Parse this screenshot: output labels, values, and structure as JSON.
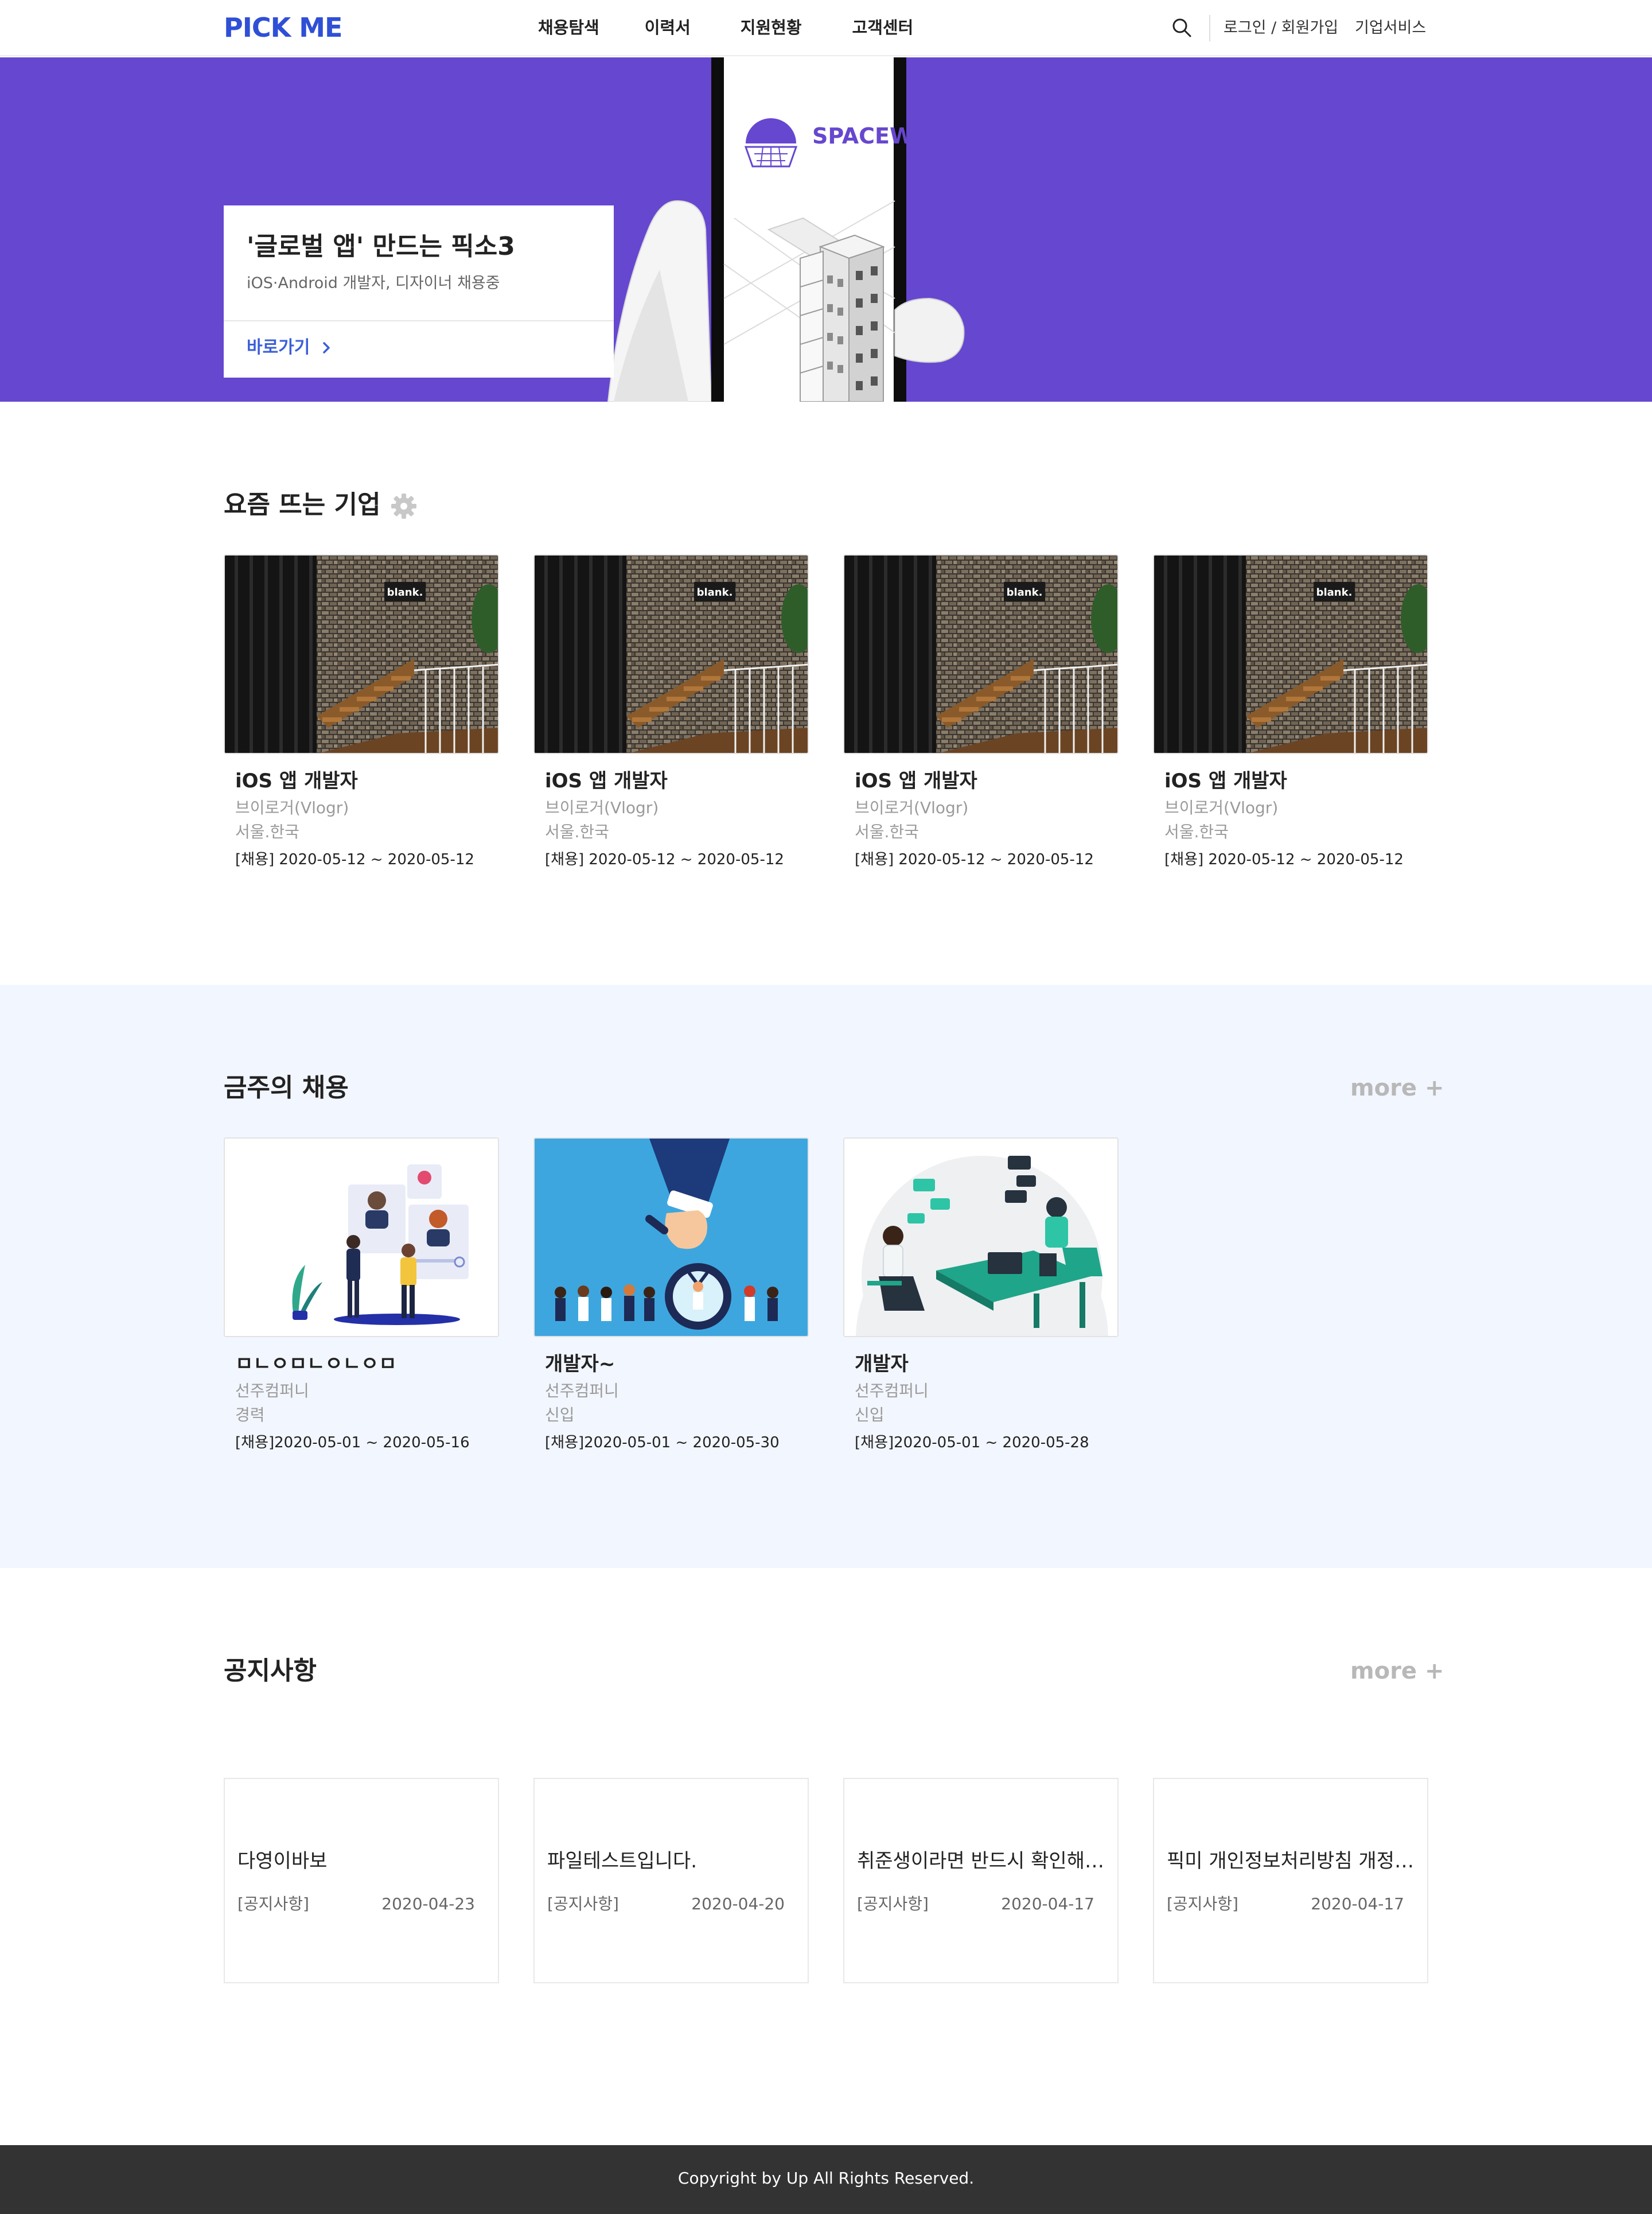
{
  "header": {
    "logo": "PICK ME",
    "nav": [
      "채용탐색",
      "이력서",
      "지원현황",
      "고객센터"
    ],
    "login_label": "로그인 / 회원가입",
    "biz_label": "기업서비스",
    "search_icon": "search-icon"
  },
  "banner": {
    "title": "'글로벌 앱' 만드는 픽소3",
    "subtitle": "iOS·Android 개발자, 디자이너 채용중",
    "link_label": "바로가기",
    "brand_text": "SPACEWALK",
    "bg_color": "#6647cf"
  },
  "hot": {
    "title": "요즘 뜨는 기업",
    "cards": [
      {
        "title": "iOS 앱 개발자",
        "company": "브이로거(Vlogr)",
        "location": "서울.한국",
        "period": "[채용] 2020-05-12 ~ 2020-05-12",
        "sign": "blank."
      },
      {
        "title": "iOS 앱 개발자",
        "company": "브이로거(Vlogr)",
        "location": "서울.한국",
        "period": "[채용] 2020-05-12 ~ 2020-05-12",
        "sign": "blank."
      },
      {
        "title": "iOS 앱 개발자",
        "company": "브이로거(Vlogr)",
        "location": "서울.한국",
        "period": "[채용] 2020-05-12 ~ 2020-05-12",
        "sign": "blank."
      },
      {
        "title": "iOS 앱 개발자",
        "company": "브이로거(Vlogr)",
        "location": "서울.한국",
        "period": "[채용] 2020-05-12 ~ 2020-05-12",
        "sign": "blank."
      }
    ]
  },
  "weekly": {
    "title": "금주의 채용",
    "more_label": "more +",
    "cards": [
      {
        "title": "ㅁㄴㅇㅁㄴㅇㄴㅇㅁ",
        "company": "선주컴퍼니",
        "level": "경력",
        "period": "[채용]2020-05-01 ~ 2020-05-16"
      },
      {
        "title": "개발자~",
        "company": "선주컴퍼니",
        "level": "신입",
        "period": "[채용]2020-05-01 ~ 2020-05-30"
      },
      {
        "title": "개발자",
        "company": "선주컴퍼니",
        "level": "신입",
        "period": "[채용]2020-05-01 ~ 2020-05-28"
      }
    ]
  },
  "notice": {
    "title": "공지사항",
    "more_label": "more +",
    "items": [
      {
        "title": "다영이바보",
        "category": "[공지사항]",
        "date": "2020-04-23"
      },
      {
        "title": "파일테스트입니다.",
        "category": "[공지사항]",
        "date": "2020-04-20"
      },
      {
        "title": "취준생이라면 반드시 확인해야 할 공지",
        "category": "[공지사항]",
        "date": "2020-04-17"
      },
      {
        "title": "픽미 개인정보처리방침 개정 안내",
        "category": "[공지사항]",
        "date": "2020-04-17"
      }
    ]
  },
  "footer": {
    "copyright": "Copyright by Up All Rights Reserved."
  },
  "colors": {
    "brand_blue": "#2f4fd6",
    "banner_purple": "#6647cf",
    "link_blue": "#3b5fd8",
    "weekly_bg": "#f2f6fe",
    "footer_bg": "#333333"
  }
}
